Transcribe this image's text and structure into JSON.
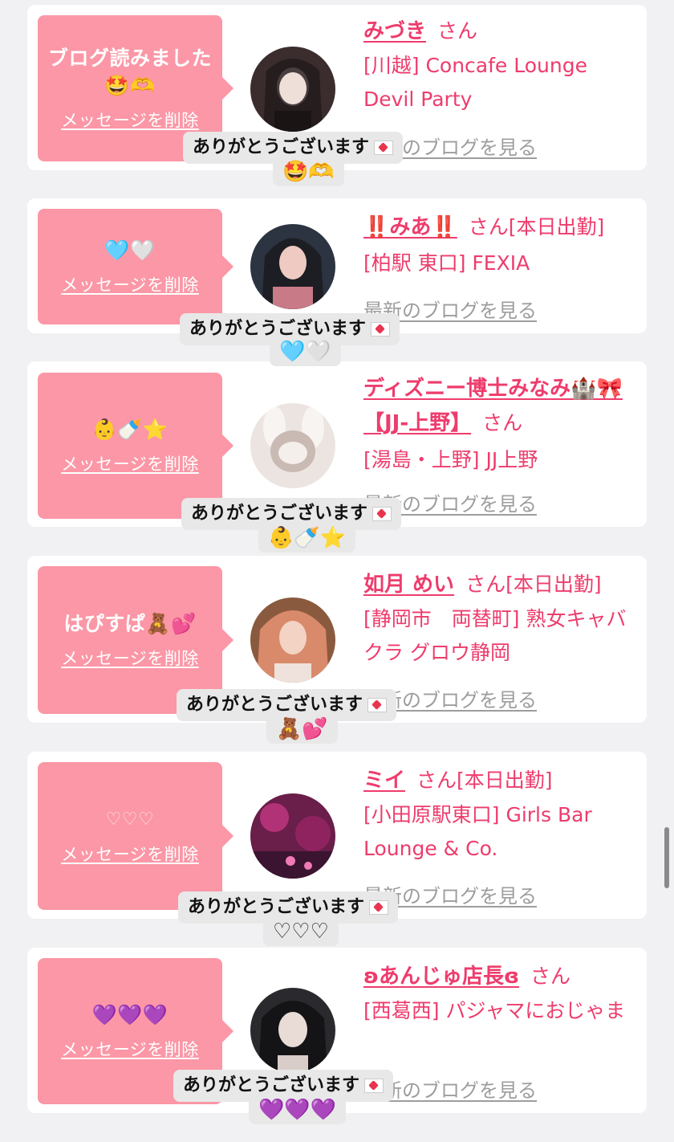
{
  "delete_label": "メッセージを削除",
  "san": "さん",
  "blog_link": "最新のブログを見る",
  "thanks": "ありがとうございます",
  "entries": [
    {
      "message": "ブログ読みました🤩🫶",
      "name": "みづき",
      "status": "",
      "shop": "[川越] Concafe Lounge Devil Party",
      "reply_emoji": "🤩🫶",
      "avatar_colors": [
        "#3b2d2e",
        "#e8d6d0"
      ]
    },
    {
      "message": "🩵🤍",
      "name": "‼️みあ‼️",
      "status": "[本日出勤]",
      "shop": "[柏駅 東口] FEXIA",
      "reply_emoji": "🩵🤍",
      "avatar_colors": [
        "#2b3440",
        "#e6b8b2"
      ]
    },
    {
      "message": "👶🍼⭐",
      "name": "ディズニー博士みなみ🏰🎀【JJ-上野】",
      "status": "",
      "shop": "[湯島・上野] JJ上野",
      "reply_emoji": "👶🍼⭐",
      "avatar_colors": [
        "#ece4e0",
        "#c9bab3"
      ]
    },
    {
      "message": "はぴすぱ🧸💕",
      "name": "如月 めい",
      "status": "[本日出勤]",
      "shop": "[静岡市　両替町] 熟女キャバクラ グロウ静岡",
      "reply_emoji": "🧸💕",
      "avatar_colors": [
        "#d98a6a",
        "#f2d3c4"
      ]
    },
    {
      "message": "♡♡♡",
      "name": "ミイ",
      "status": "[本日出勤]",
      "shop": "[小田原駅東口] Girls Bar Lounge & Co.",
      "reply_emoji": "♡♡♡",
      "avatar_colors": [
        "#6a1e4a",
        "#d23b8a"
      ]
    },
    {
      "message": "💜💜💜",
      "name": "ʚあんじゅ店長ɞ",
      "status": "",
      "shop": "[西葛西] パジャマにおじゃま",
      "reply_emoji": "💜💜💜",
      "avatar_colors": [
        "#2a2a2e",
        "#e9dcd6"
      ]
    }
  ]
}
